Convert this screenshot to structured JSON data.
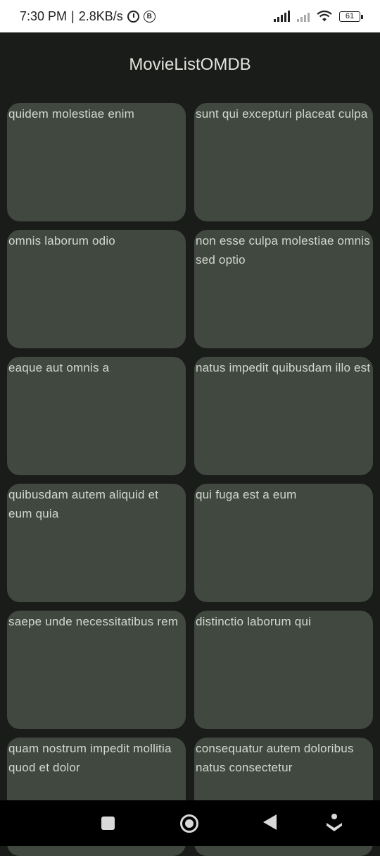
{
  "status_bar": {
    "time": "7:30 PM",
    "speed": "2.8KB/s",
    "separator": "|",
    "b_badge": "B",
    "battery": "61"
  },
  "app_bar": {
    "title": "MovieListOMDB"
  },
  "movies": [
    {
      "title": "quidem molestiae enim"
    },
    {
      "title": "sunt qui excepturi placeat culpa"
    },
    {
      "title": "omnis laborum odio"
    },
    {
      "title": "non esse culpa molestiae omnis sed optio"
    },
    {
      "title": "eaque aut omnis a"
    },
    {
      "title": "natus impedit quibusdam illo est"
    },
    {
      "title": "quibusdam autem aliquid et eum quia"
    },
    {
      "title": "qui fuga est a eum"
    },
    {
      "title": "saepe unde necessitatibus rem"
    },
    {
      "title": "distinctio laborum qui"
    },
    {
      "title": "quam nostrum impedit mollitia quod et dolor"
    },
    {
      "title": "consequatur autem doloribus natus consectetur"
    }
  ],
  "colors": {
    "background": "#191c19",
    "card": "#414840",
    "card_text": "#d3d7cf",
    "title_text": "#e2e3de",
    "nav_bar": "#000000"
  },
  "icons": {
    "status": [
      "alarm-icon",
      "b-badge-icon",
      "signal-icon",
      "signal-weak-icon",
      "wifi-icon",
      "battery-icon"
    ],
    "nav": [
      "recents-icon",
      "home-icon",
      "back-icon",
      "assistant-icon"
    ]
  }
}
